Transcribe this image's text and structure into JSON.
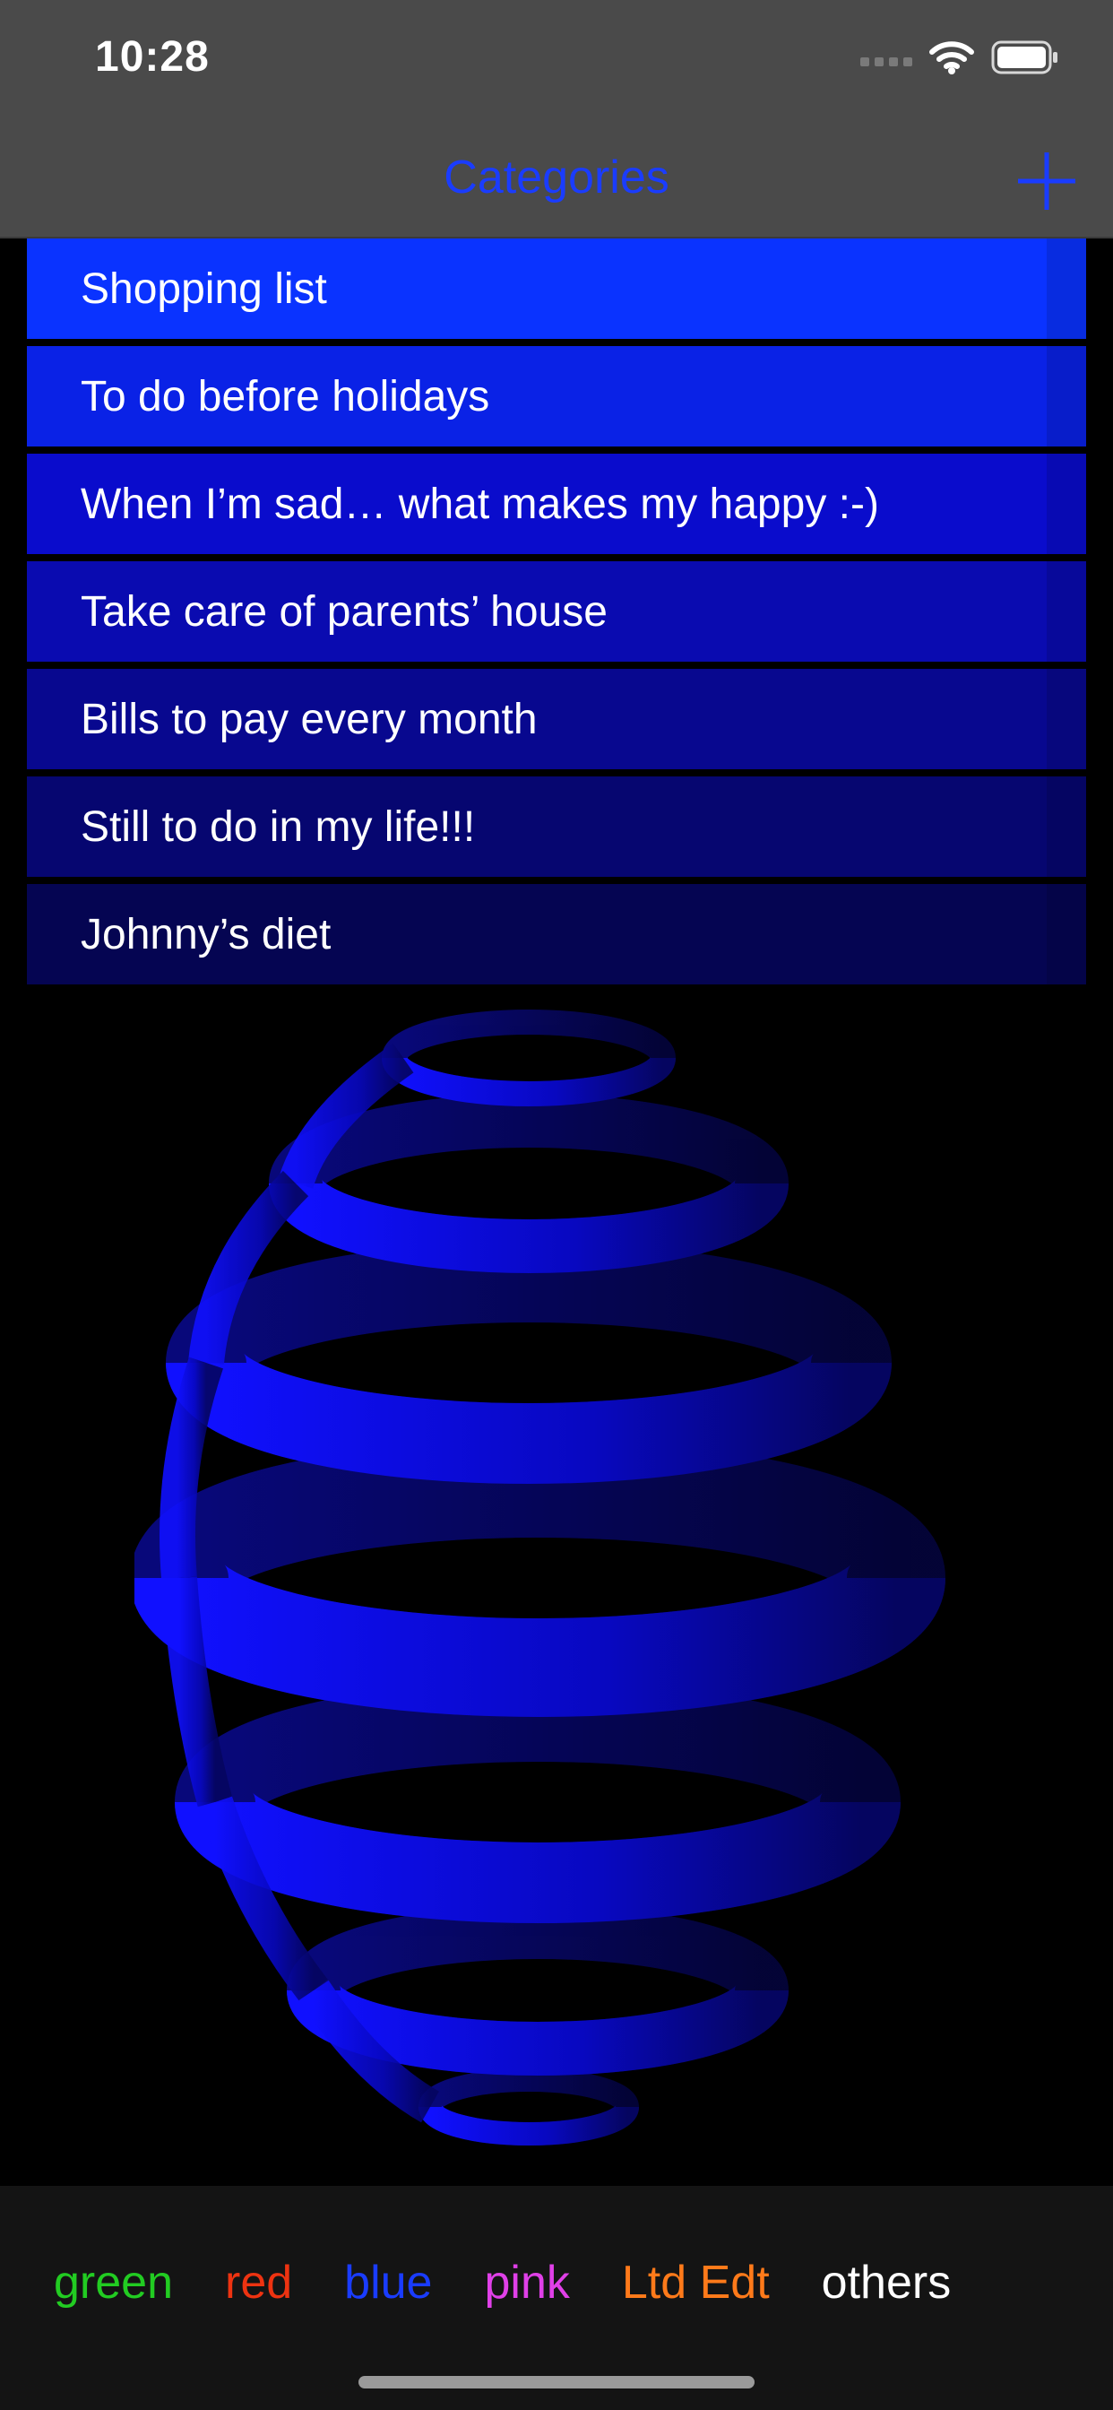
{
  "status": {
    "time": "10:28"
  },
  "nav": {
    "title": "Categories"
  },
  "categories": [
    {
      "label": "Shopping list",
      "color": "#0a33ff"
    },
    {
      "label": "To do before holidays",
      "color": "#0a22e6"
    },
    {
      "label": "When I’m sad… what makes my happy :-)",
      "color": "#0a0ccc"
    },
    {
      "label": "Take care of parents’ house",
      "color": "#0a0bb0"
    },
    {
      "label": "Bills to pay every month",
      "color": "#08088f"
    },
    {
      "label": "Still to do in my life!!!",
      "color": "#060670"
    },
    {
      "label": "Johnny’s diet",
      "color": "#050552"
    }
  ],
  "tabs": [
    {
      "label": "green",
      "color": "#22cc22"
    },
    {
      "label": "red",
      "color": "#ee3311"
    },
    {
      "label": "blue",
      "color": "#1a3cff"
    },
    {
      "label": "pink",
      "color": "#e040e8"
    },
    {
      "label": "Ltd Edt",
      "color": "#ff7a1a"
    },
    {
      "label": "others",
      "color": "#ffffff"
    }
  ],
  "icons": {
    "add": "plus-icon",
    "signal": "cellular-signal-icon",
    "wifi": "wifi-icon",
    "battery": "battery-icon"
  }
}
